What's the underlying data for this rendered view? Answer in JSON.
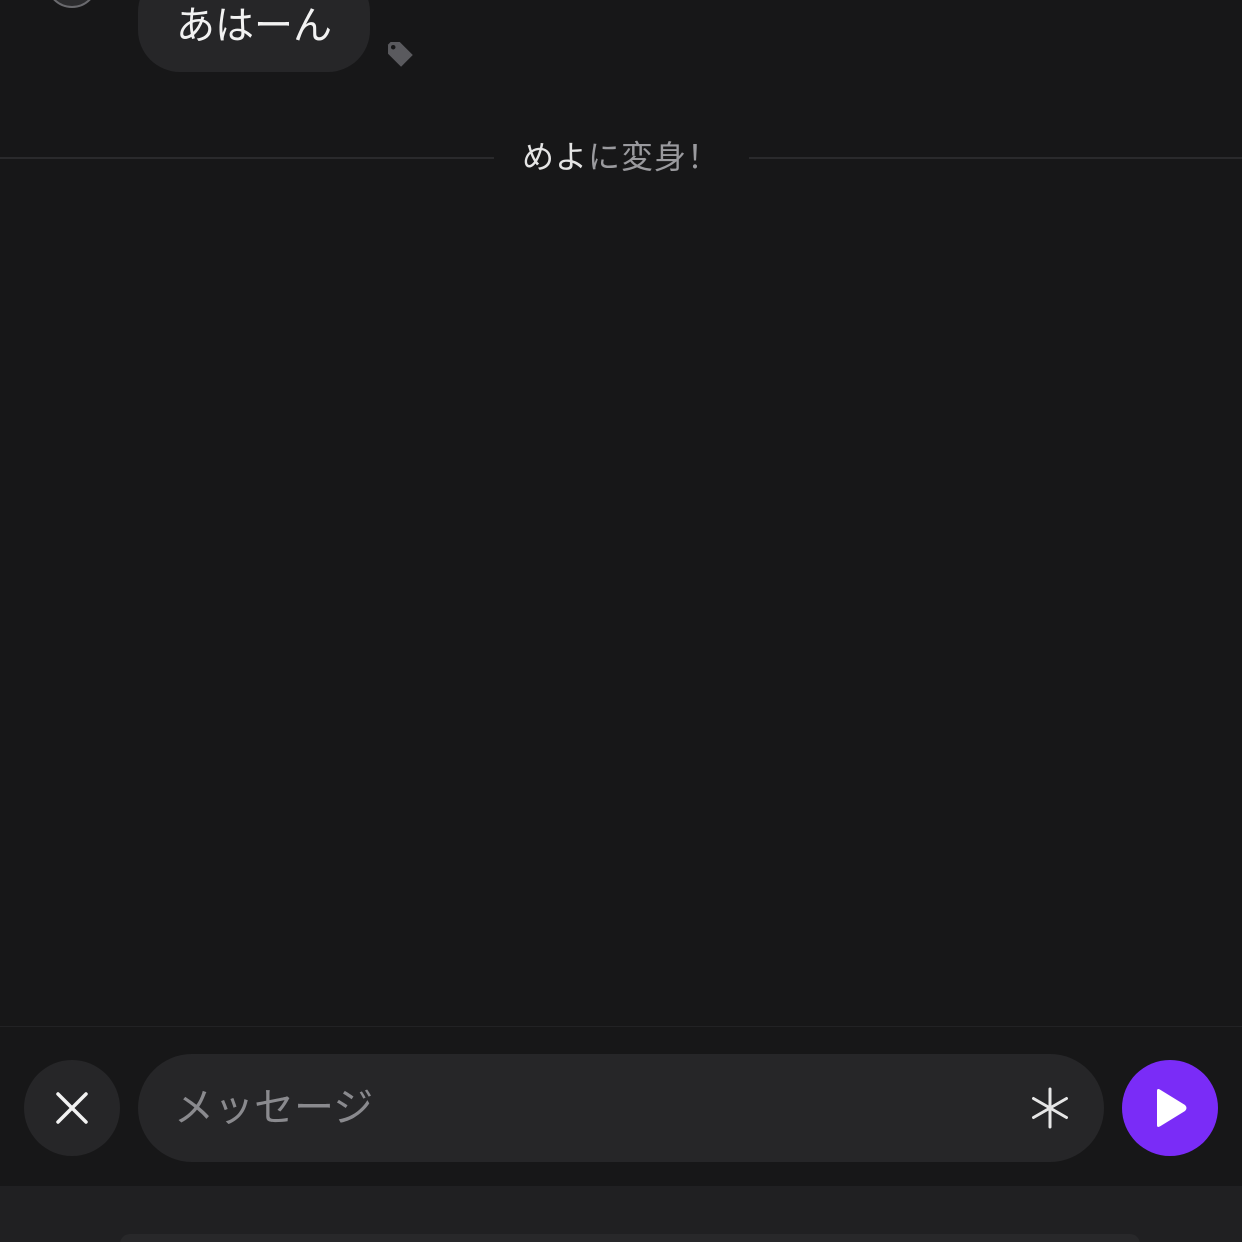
{
  "chat": {
    "message_text": "あはーん",
    "system_message": {
      "name": "めよ",
      "suffix": "に変身！"
    }
  },
  "composer": {
    "placeholder": "メッセージ",
    "value": ""
  },
  "icons": {
    "close": "close-icon",
    "tag": "tag-icon",
    "asterisk": "asterisk-icon",
    "send": "play-icon"
  },
  "colors": {
    "background": "#171718",
    "bubble": "#262628",
    "accent": "#7a2cf7"
  }
}
